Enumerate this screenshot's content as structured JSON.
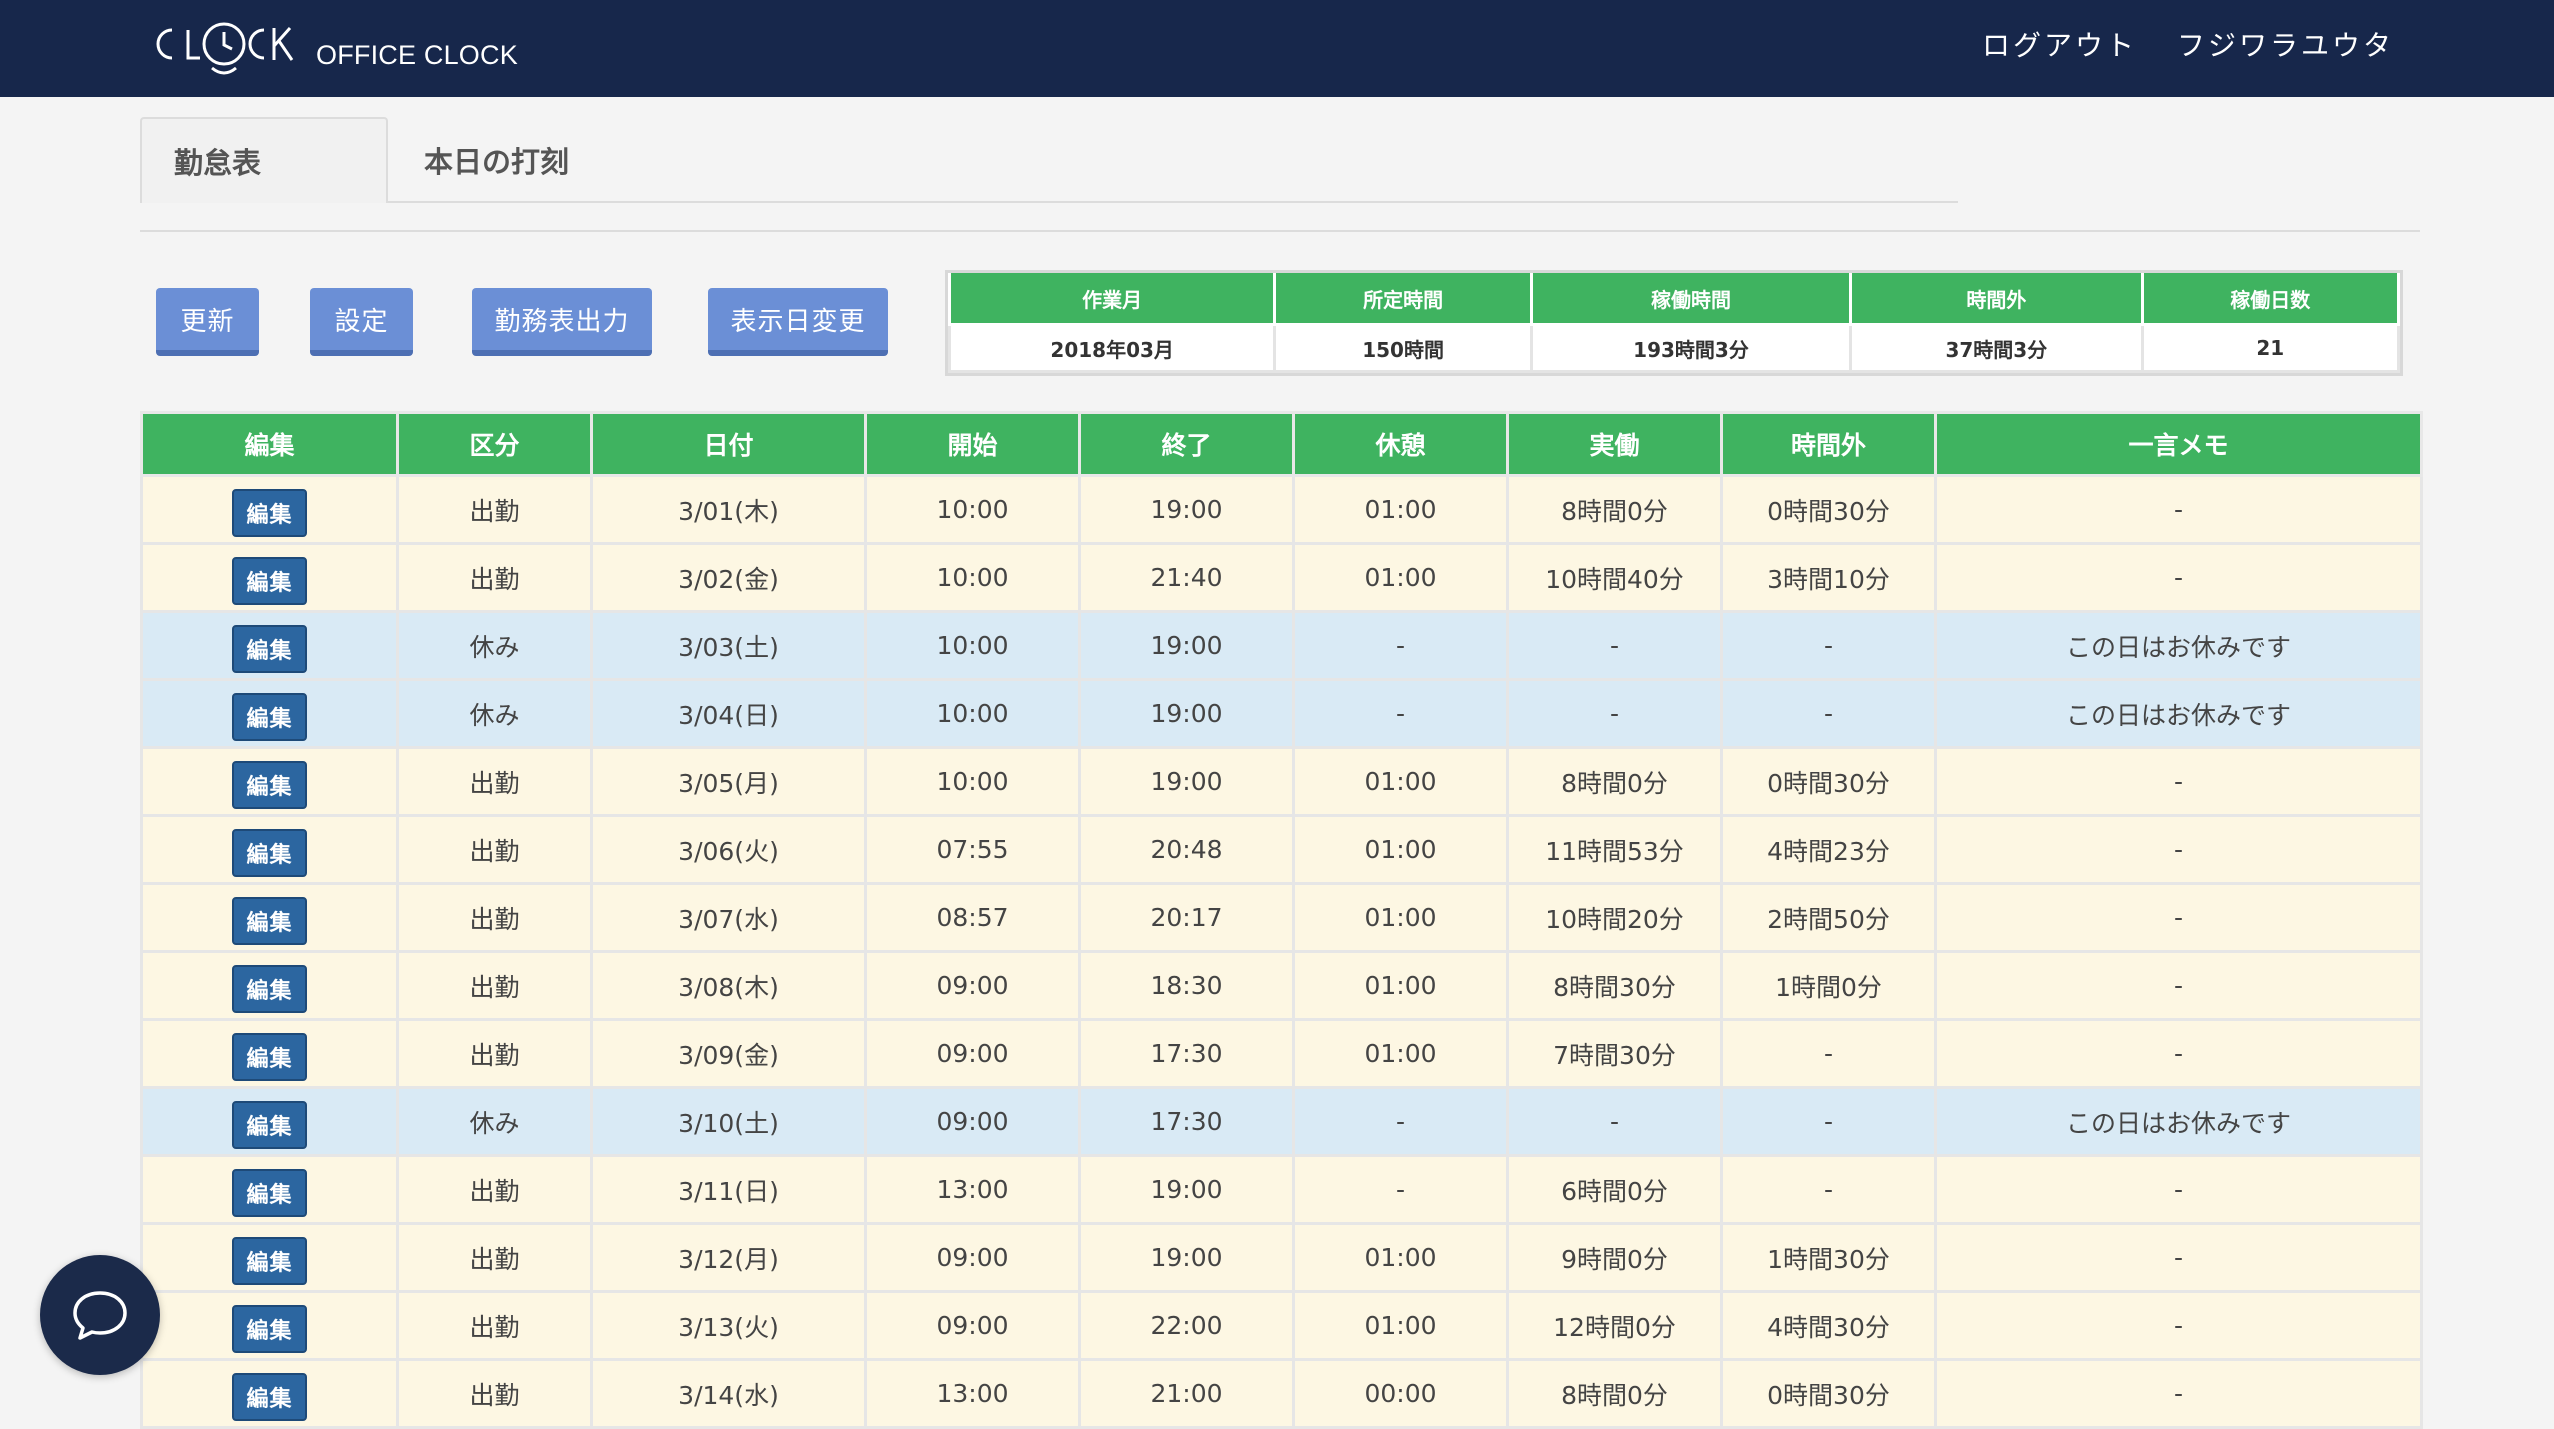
{
  "header": {
    "logo_text": "CLOCK",
    "logo_sub": "OFFICE CLOCK",
    "nav": [
      "ログアウト",
      "フジワラユウタ"
    ]
  },
  "tabs": [
    "勤怠表",
    "本日の打刻"
  ],
  "toolbar": {
    "buttons": [
      "更新",
      "設定",
      "勤務表出力",
      "表示日変更"
    ]
  },
  "summary": {
    "headers": [
      "作業月",
      "所定時間",
      "稼働時間",
      "時間外",
      "稼働日数"
    ],
    "values": [
      "2018年03月",
      "150時間",
      "193時間3分",
      "37時間3分",
      "21"
    ]
  },
  "table": {
    "headers": [
      "編集",
      "区分",
      "日付",
      "開始",
      "終了",
      "休憩",
      "実働",
      "時間外",
      "一言メモ"
    ],
    "edit_label": "編集",
    "rows": [
      {
        "type": "work",
        "kubun": "出勤",
        "date": "3/01(木)",
        "start": "10:00",
        "end": "19:00",
        "break": "01:00",
        "actual": "8時間0分",
        "overtime": "0時間30分",
        "memo": "-"
      },
      {
        "type": "work",
        "kubun": "出勤",
        "date": "3/02(金)",
        "start": "10:00",
        "end": "21:40",
        "break": "01:00",
        "actual": "10時間40分",
        "overtime": "3時間10分",
        "memo": "-"
      },
      {
        "type": "off",
        "kubun": "休み",
        "date": "3/03(土)",
        "start": "10:00",
        "end": "19:00",
        "break": "-",
        "actual": "-",
        "overtime": "-",
        "memo": "この日はお休みです"
      },
      {
        "type": "off",
        "kubun": "休み",
        "date": "3/04(日)",
        "start": "10:00",
        "end": "19:00",
        "break": "-",
        "actual": "-",
        "overtime": "-",
        "memo": "この日はお休みです"
      },
      {
        "type": "work",
        "kubun": "出勤",
        "date": "3/05(月)",
        "start": "10:00",
        "end": "19:00",
        "break": "01:00",
        "actual": "8時間0分",
        "overtime": "0時間30分",
        "memo": "-"
      },
      {
        "type": "work",
        "kubun": "出勤",
        "date": "3/06(火)",
        "start": "07:55",
        "end": "20:48",
        "break": "01:00",
        "actual": "11時間53分",
        "overtime": "4時間23分",
        "memo": "-"
      },
      {
        "type": "work",
        "kubun": "出勤",
        "date": "3/07(水)",
        "start": "08:57",
        "end": "20:17",
        "break": "01:00",
        "actual": "10時間20分",
        "overtime": "2時間50分",
        "memo": "-"
      },
      {
        "type": "work",
        "kubun": "出勤",
        "date": "3/08(木)",
        "start": "09:00",
        "end": "18:30",
        "break": "01:00",
        "actual": "8時間30分",
        "overtime": "1時間0分",
        "memo": "-"
      },
      {
        "type": "work",
        "kubun": "出勤",
        "date": "3/09(金)",
        "start": "09:00",
        "end": "17:30",
        "break": "01:00",
        "actual": "7時間30分",
        "overtime": "-",
        "memo": "-"
      },
      {
        "type": "off",
        "kubun": "休み",
        "date": "3/10(土)",
        "start": "09:00",
        "end": "17:30",
        "break": "-",
        "actual": "-",
        "overtime": "-",
        "memo": "この日はお休みです"
      },
      {
        "type": "work",
        "kubun": "出勤",
        "date": "3/11(日)",
        "start": "13:00",
        "end": "19:00",
        "break": "-",
        "actual": "6時間0分",
        "overtime": "-",
        "memo": "-"
      },
      {
        "type": "work",
        "kubun": "出勤",
        "date": "3/12(月)",
        "start": "09:00",
        "end": "19:00",
        "break": "01:00",
        "actual": "9時間0分",
        "overtime": "1時間30分",
        "memo": "-"
      },
      {
        "type": "work",
        "kubun": "出勤",
        "date": "3/13(火)",
        "start": "09:00",
        "end": "22:00",
        "break": "01:00",
        "actual": "12時間0分",
        "overtime": "4時間30分",
        "memo": "-"
      },
      {
        "type": "work",
        "kubun": "出勤",
        "date": "3/14(水)",
        "start": "13:00",
        "end": "21:00",
        "break": "00:00",
        "actual": "8時間0分",
        "overtime": "0時間30分",
        "memo": "-"
      }
    ]
  },
  "colors": {
    "header_bg": "#17274b",
    "accent_green": "#3fb360",
    "button_blue": "#6b8fd6",
    "edit_blue": "#2c66a0",
    "work_row": "#fdf7e3",
    "off_row": "#d9eaf5"
  },
  "icons": {
    "logo": "clock-face-logo",
    "chat": "chat-bubble-icon"
  }
}
